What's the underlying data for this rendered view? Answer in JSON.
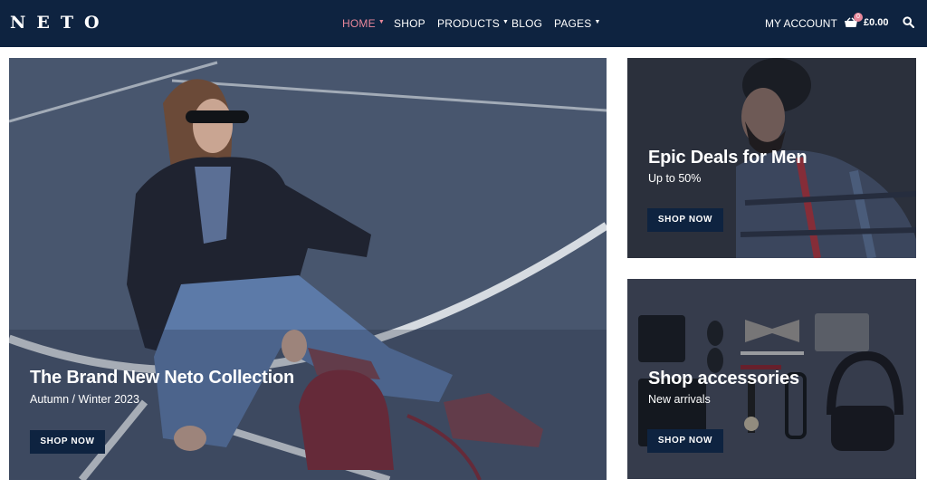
{
  "header": {
    "logo": "NETO",
    "nav": [
      {
        "label": "HOME",
        "active": true,
        "has_dropdown": true
      },
      {
        "label": "SHOP",
        "active": false,
        "has_dropdown": false
      },
      {
        "label": "PRODUCTS",
        "active": false,
        "has_dropdown": true
      },
      {
        "label": "BLOG",
        "active": false,
        "has_dropdown": false
      },
      {
        "label": "PAGES",
        "active": false,
        "has_dropdown": true
      }
    ],
    "account_label": "MY ACCOUNT",
    "cart_count": "0",
    "cart_total": "£0.00",
    "icons": {
      "cart": "shopping-basket-icon",
      "search": "search-icon"
    }
  },
  "banners": {
    "main": {
      "title": "The Brand New Neto Collection",
      "subtitle": "Autumn / Winter 2023",
      "button": "SHOP NOW"
    },
    "men": {
      "title": "Epic Deals for Men",
      "subtitle": "Up to 50%",
      "button": "SHOP NOW"
    },
    "accessories": {
      "title": "Shop accessories",
      "subtitle": "New arrivals",
      "button": "SHOP NOW"
    }
  },
  "colors": {
    "header_bg": "#0e2340",
    "active_nav": "#e8879a",
    "button_bg": "#0e2340"
  }
}
